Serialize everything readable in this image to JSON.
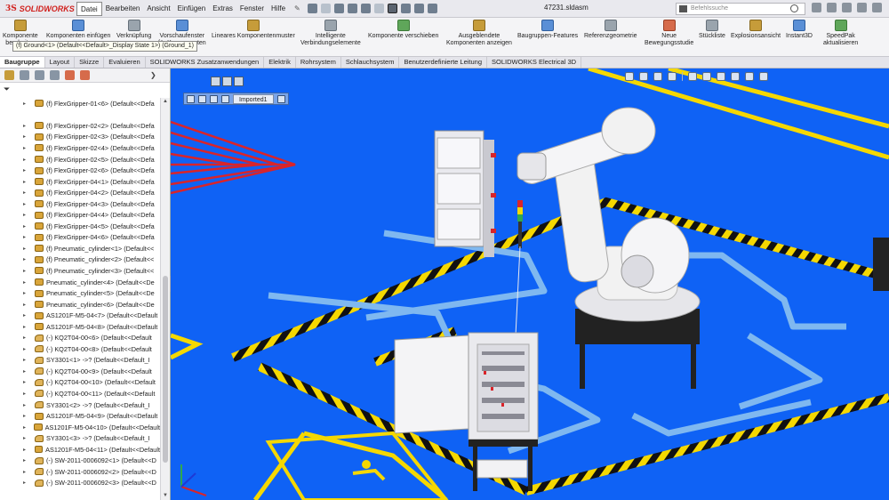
{
  "app": {
    "brand": "SOLIDWORKS",
    "brand_mark": "3S",
    "filename": "47231.sldasm"
  },
  "menu": [
    "Datei",
    "Bearbeiten",
    "Ansicht",
    "Einfügen",
    "Extras",
    "Fenster",
    "Hilfe"
  ],
  "search": {
    "placeholder": "Befehlssuche"
  },
  "ribbon": [
    {
      "id": "komponente-bearbeiten",
      "label": "Komponente\nbearbeiten"
    },
    {
      "id": "komponenten-einfuegen",
      "label": "Komponenten einfügen"
    },
    {
      "id": "verknuepfung",
      "label": "Verknüpfung"
    },
    {
      "id": "vorschaufenster",
      "label": "Vorschaufenster\nfür Komponenten"
    },
    {
      "id": "lineares-komponentenmuster",
      "label": "Lineares Komponentenmuster"
    },
    {
      "id": "intelligente-verbindungselemente",
      "label": "Intelligente\nVerbindungselemente"
    },
    {
      "id": "komponente-verschieben",
      "label": "Komponente verschieben"
    },
    {
      "id": "ausgeblendete-komponenten",
      "label": "Ausgeblendete\nKomponenten anzeigen"
    },
    {
      "id": "baugruppen-features",
      "label": "Baugruppen-Features"
    },
    {
      "id": "referenzgeometrie",
      "label": "Referenzgeometrie"
    },
    {
      "id": "neue-bewegungsstudie",
      "label": "Neue\nBewegungsstudie"
    },
    {
      "id": "stueckliste",
      "label": "Stückliste"
    },
    {
      "id": "explosionsansicht",
      "label": "Explosionsansicht"
    },
    {
      "id": "instant3d",
      "label": "Instant3D"
    },
    {
      "id": "speedpak",
      "label": "SpeedPak\naktualisieren"
    }
  ],
  "tabs": [
    "Baugruppe",
    "Layout",
    "Skizze",
    "Evaluieren",
    "SOLIDWORKS Zusatzanwendungen",
    "Elektrik",
    "Rohrsystem",
    "Schlauchsystem",
    "Benutzerdefinierte Leitung",
    "SOLIDWORKS Electrical 3D"
  ],
  "active_tab": "Baugruppe",
  "tooltip": "(f) Ground<1> (Default<<Default>_Display State 1>) (Ground_1)",
  "viewport": {
    "imported_label": "Imported1"
  },
  "tree": [
    "(f) FlexGripper-01<6> (Default<<Defa",
    "",
    "(f) FlexGripper-02<2> (Default<<Defa",
    "(f) FlexGripper-02<3> (Default<<Defa",
    "(f) FlexGripper-02<4> (Default<<Defa",
    "(f) FlexGripper-02<5> (Default<<Defa",
    "(f) FlexGripper-02<6> (Default<<Defa",
    "(f) FlexGripper-04<1> (Default<<Defa",
    "(f) FlexGripper-04<2> (Default<<Defa",
    "(f) FlexGripper-04<3> (Default<<Defa",
    "(f) FlexGripper-04<4> (Default<<Defa",
    "(f) FlexGripper-04<5> (Default<<Defa",
    "(f) FlexGripper-04<6> (Default<<Defa",
    "(f) Pneumatic_cylinder<1> (Default<<",
    "(f) Pneumatic_cylinder<2> (Default<<",
    "(f) Pneumatic_cylinder<3> (Default<<",
    "Pneumatic_cylinder<4> (Default<<De",
    "Pneumatic_cylinder<5> (Default<<De",
    "Pneumatic_cylinder<6> (Default<<De",
    "AS1201F-M5-04<7> (Default<<Default",
    "AS1201F-M5-04<8> (Default<<Default",
    "(-) KQ2T04-00<6> (Default<<Default",
    "(-) KQ2T04-00<8> (Default<<Default",
    "SY3301<1> ->? (Default<<Default_I",
    "(-) KQ2T04-00<9> (Default<<Default",
    "(-) KQ2T04-00<10> (Default<<Default",
    "(-) KQ2T04-00<11> (Default<<Default",
    "SY3301<2> ->? (Default<<Default_I",
    "AS1201F-M5-04<9> (Default<<Default",
    "AS1201F-M5-04<10> (Default<<Default",
    "SY3301<3> ->? (Default<<Default_I",
    "AS1201F-M5-04<11> (Default<<Default",
    "(-) SW-2011-0006092<1> (Default<<D",
    "(-) SW-2011-0006092<2> (Default<<D",
    "(-) SW-2011-0006092<3> (Default<<D"
  ],
  "colors": {
    "floor": "#0f62f5",
    "stripe_yellow": "#f5d800",
    "stripe_black": "#111111",
    "robot": "#f2f2f2",
    "guide_line": "#d9242a"
  }
}
